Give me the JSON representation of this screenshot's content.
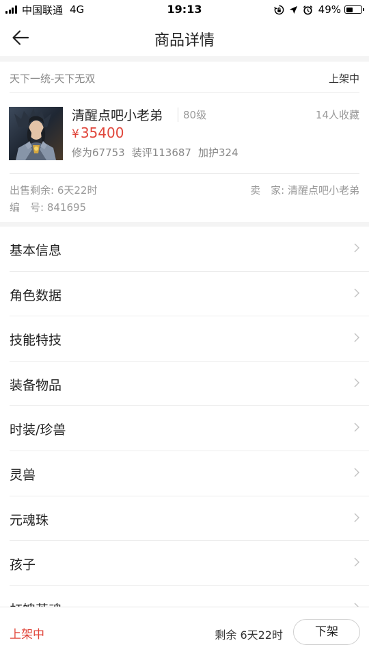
{
  "status_bar": {
    "carrier": "中国联通",
    "network": "4G",
    "time": "19:13",
    "battery_percent": "49%",
    "battery_level": 0.49
  },
  "header": {
    "title": "商品详情",
    "back_icon": "arrow-left-icon"
  },
  "product": {
    "server": "天下一统-天下无双",
    "listing_status": "上架中",
    "character_name": "清醒点吧小老弟",
    "level": "80级",
    "favorites": "14人收藏",
    "price_symbol": "¥",
    "price": "35400",
    "stats": {
      "cultivation": "修为67753",
      "equipment_score": "装评113687",
      "protection": "加护324"
    },
    "sell_remaining": "出售剩余: 6天22时",
    "seller": "卖　家: 清醒点吧小老弟",
    "serial": "编　号: 841695"
  },
  "menu": [
    {
      "label": "基本信息"
    },
    {
      "label": "角色数据"
    },
    {
      "label": "技能特技"
    },
    {
      "label": "装备物品"
    },
    {
      "label": "时装/珍兽"
    },
    {
      "label": "灵兽"
    },
    {
      "label": "元魂珠"
    },
    {
      "label": "孩子"
    },
    {
      "label": "虹魄英魂"
    }
  ],
  "bottom_bar": {
    "status": "上架中",
    "remaining": "剩余 6天22时",
    "button": "下架"
  },
  "colors": {
    "accent_red": "#e0453a",
    "text_dark": "#222222",
    "text_muted": "#999999",
    "divider": "#ececec"
  }
}
